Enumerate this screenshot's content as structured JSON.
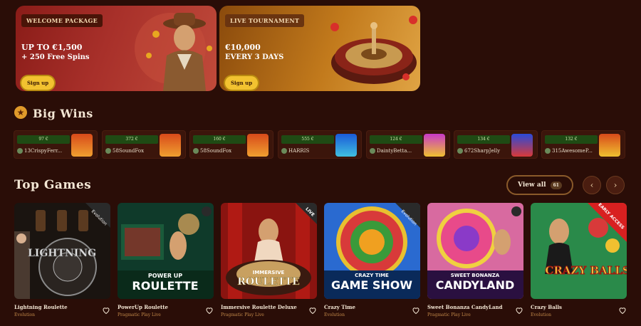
{
  "promos": [
    {
      "tag": "Welcome Package",
      "line1": "UP TO €1,500",
      "line2": "+ 250 Free Spins",
      "cta": "Sign up"
    },
    {
      "tag": "Live Tournament",
      "line1": "€10,000",
      "line2": "EVERY 3 DAYS",
      "cta": "Sign up"
    }
  ],
  "big_wins": {
    "title": "Big Wins",
    "icon": "star-icon",
    "items": [
      {
        "amount": "97 €",
        "user": "13CrispyFerr..."
      },
      {
        "amount": "372 €",
        "user": "58SoundFox"
      },
      {
        "amount": "160 €",
        "user": "58SoundFox"
      },
      {
        "amount": "555 €",
        "user": "HARRIS"
      },
      {
        "amount": "124 €",
        "user": "DaintyBetta..."
      },
      {
        "amount": "134 €",
        "user": "672SharpJelly"
      },
      {
        "amount": "132 €",
        "user": "315AwesomeP..."
      }
    ]
  },
  "top_games": {
    "title": "Top Games",
    "view_all": "View all",
    "count": "61",
    "prev_icon": "chevron-left-icon",
    "next_icon": "chevron-right-icon",
    "games": [
      {
        "name": "Lightning Roulette",
        "provider": "Evolution",
        "tile_text": "LIGHTNING",
        "tile_sub": "",
        "badge": "Evolution"
      },
      {
        "name": "PowerUp Roulette",
        "provider": "Pragmatic Play Live",
        "tile_text": "ROULETTE",
        "tile_sub": "POWER UP",
        "badge": ""
      },
      {
        "name": "Immersive Roulette Deluxe",
        "provider": "Pragmatic Play Live",
        "tile_text": "ROULETTE",
        "tile_sub": "IMMERSIVE",
        "badge": "LIVE"
      },
      {
        "name": "Crazy Time",
        "provider": "Evolution",
        "tile_text": "GAME SHOW",
        "tile_sub": "CRAZY TIME",
        "badge": "Evolution"
      },
      {
        "name": "Sweet Bonanza CandyLand",
        "provider": "Pragmatic Play Live",
        "tile_text": "CANDYLAND",
        "tile_sub": "SWEET BONANZA",
        "badge": ""
      },
      {
        "name": "Crazy Balls",
        "provider": "Evolution",
        "tile_text": "CRAZY BALLS",
        "tile_sub": "",
        "badge": "EARLY ACCESS"
      }
    ]
  },
  "colors": {
    "background": "#2a0d07",
    "accent": "#f2c230",
    "win_amount_bg": "#1f4a14",
    "provider_text": "#c48a4a"
  }
}
